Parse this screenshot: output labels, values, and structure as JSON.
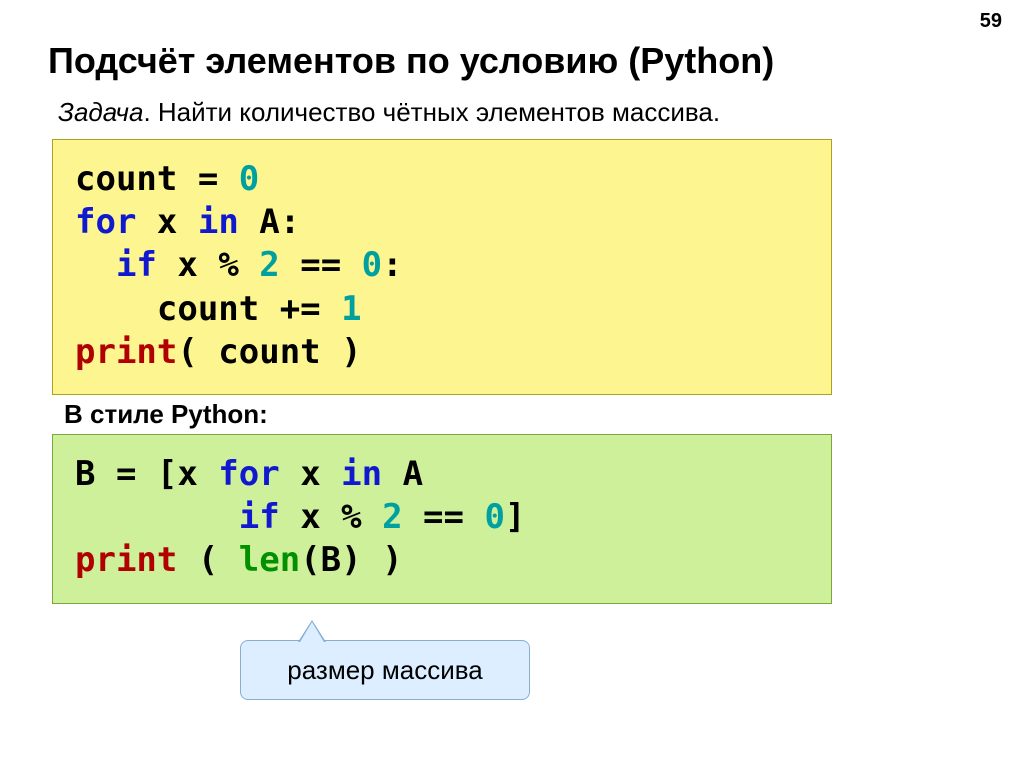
{
  "page_number": "59",
  "title": "Подсчёт элементов по условию (Python)",
  "task_label": "Задача",
  "task_text": ". Найти количество чётных элементов массива.",
  "code1": {
    "l1_a": "count = ",
    "l1_b": "0",
    "l2_a": "for",
    "l2_b": " x ",
    "l2_c": "in",
    "l2_d": " A:",
    "l3_a": "  ",
    "l3_b": "if",
    "l3_c": " x % ",
    "l3_d": "2",
    "l3_e": " == ",
    "l3_f": "0",
    "l3_g": ":",
    "l4_a": "    count += ",
    "l4_b": "1",
    "l5_a": "print",
    "l5_b": "( count )"
  },
  "section_label": "В стиле Python:",
  "code2": {
    "l1_a": "B = [x ",
    "l1_b": "for",
    "l1_c": " x ",
    "l1_d": "in",
    "l1_e": " A",
    "l2_a": "        ",
    "l2_b": "if",
    "l2_c": " x % ",
    "l2_d": "2",
    "l2_e": " == ",
    "l2_f": "0",
    "l2_g": "]",
    "l3_a": "print",
    "l3_b": " ( ",
    "l3_c": "len",
    "l3_d": "(B) )"
  },
  "callout": "размер массива"
}
